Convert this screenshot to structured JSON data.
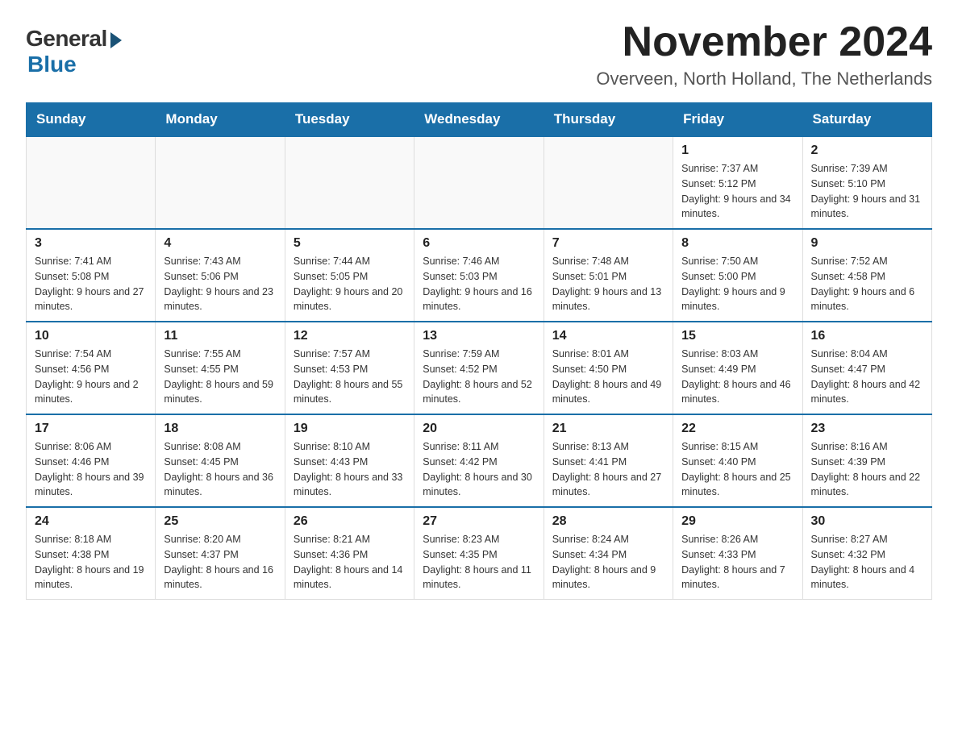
{
  "logo": {
    "general": "General",
    "blue": "Blue"
  },
  "title": "November 2024",
  "subtitle": "Overveen, North Holland, The Netherlands",
  "days_of_week": [
    "Sunday",
    "Monday",
    "Tuesday",
    "Wednesday",
    "Thursday",
    "Friday",
    "Saturday"
  ],
  "weeks": [
    [
      {
        "day": "",
        "info": ""
      },
      {
        "day": "",
        "info": ""
      },
      {
        "day": "",
        "info": ""
      },
      {
        "day": "",
        "info": ""
      },
      {
        "day": "",
        "info": ""
      },
      {
        "day": "1",
        "info": "Sunrise: 7:37 AM\nSunset: 5:12 PM\nDaylight: 9 hours and 34 minutes."
      },
      {
        "day": "2",
        "info": "Sunrise: 7:39 AM\nSunset: 5:10 PM\nDaylight: 9 hours and 31 minutes."
      }
    ],
    [
      {
        "day": "3",
        "info": "Sunrise: 7:41 AM\nSunset: 5:08 PM\nDaylight: 9 hours and 27 minutes."
      },
      {
        "day": "4",
        "info": "Sunrise: 7:43 AM\nSunset: 5:06 PM\nDaylight: 9 hours and 23 minutes."
      },
      {
        "day": "5",
        "info": "Sunrise: 7:44 AM\nSunset: 5:05 PM\nDaylight: 9 hours and 20 minutes."
      },
      {
        "day": "6",
        "info": "Sunrise: 7:46 AM\nSunset: 5:03 PM\nDaylight: 9 hours and 16 minutes."
      },
      {
        "day": "7",
        "info": "Sunrise: 7:48 AM\nSunset: 5:01 PM\nDaylight: 9 hours and 13 minutes."
      },
      {
        "day": "8",
        "info": "Sunrise: 7:50 AM\nSunset: 5:00 PM\nDaylight: 9 hours and 9 minutes."
      },
      {
        "day": "9",
        "info": "Sunrise: 7:52 AM\nSunset: 4:58 PM\nDaylight: 9 hours and 6 minutes."
      }
    ],
    [
      {
        "day": "10",
        "info": "Sunrise: 7:54 AM\nSunset: 4:56 PM\nDaylight: 9 hours and 2 minutes."
      },
      {
        "day": "11",
        "info": "Sunrise: 7:55 AM\nSunset: 4:55 PM\nDaylight: 8 hours and 59 minutes."
      },
      {
        "day": "12",
        "info": "Sunrise: 7:57 AM\nSunset: 4:53 PM\nDaylight: 8 hours and 55 minutes."
      },
      {
        "day": "13",
        "info": "Sunrise: 7:59 AM\nSunset: 4:52 PM\nDaylight: 8 hours and 52 minutes."
      },
      {
        "day": "14",
        "info": "Sunrise: 8:01 AM\nSunset: 4:50 PM\nDaylight: 8 hours and 49 minutes."
      },
      {
        "day": "15",
        "info": "Sunrise: 8:03 AM\nSunset: 4:49 PM\nDaylight: 8 hours and 46 minutes."
      },
      {
        "day": "16",
        "info": "Sunrise: 8:04 AM\nSunset: 4:47 PM\nDaylight: 8 hours and 42 minutes."
      }
    ],
    [
      {
        "day": "17",
        "info": "Sunrise: 8:06 AM\nSunset: 4:46 PM\nDaylight: 8 hours and 39 minutes."
      },
      {
        "day": "18",
        "info": "Sunrise: 8:08 AM\nSunset: 4:45 PM\nDaylight: 8 hours and 36 minutes."
      },
      {
        "day": "19",
        "info": "Sunrise: 8:10 AM\nSunset: 4:43 PM\nDaylight: 8 hours and 33 minutes."
      },
      {
        "day": "20",
        "info": "Sunrise: 8:11 AM\nSunset: 4:42 PM\nDaylight: 8 hours and 30 minutes."
      },
      {
        "day": "21",
        "info": "Sunrise: 8:13 AM\nSunset: 4:41 PM\nDaylight: 8 hours and 27 minutes."
      },
      {
        "day": "22",
        "info": "Sunrise: 8:15 AM\nSunset: 4:40 PM\nDaylight: 8 hours and 25 minutes."
      },
      {
        "day": "23",
        "info": "Sunrise: 8:16 AM\nSunset: 4:39 PM\nDaylight: 8 hours and 22 minutes."
      }
    ],
    [
      {
        "day": "24",
        "info": "Sunrise: 8:18 AM\nSunset: 4:38 PM\nDaylight: 8 hours and 19 minutes."
      },
      {
        "day": "25",
        "info": "Sunrise: 8:20 AM\nSunset: 4:37 PM\nDaylight: 8 hours and 16 minutes."
      },
      {
        "day": "26",
        "info": "Sunrise: 8:21 AM\nSunset: 4:36 PM\nDaylight: 8 hours and 14 minutes."
      },
      {
        "day": "27",
        "info": "Sunrise: 8:23 AM\nSunset: 4:35 PM\nDaylight: 8 hours and 11 minutes."
      },
      {
        "day": "28",
        "info": "Sunrise: 8:24 AM\nSunset: 4:34 PM\nDaylight: 8 hours and 9 minutes."
      },
      {
        "day": "29",
        "info": "Sunrise: 8:26 AM\nSunset: 4:33 PM\nDaylight: 8 hours and 7 minutes."
      },
      {
        "day": "30",
        "info": "Sunrise: 8:27 AM\nSunset: 4:32 PM\nDaylight: 8 hours and 4 minutes."
      }
    ]
  ]
}
